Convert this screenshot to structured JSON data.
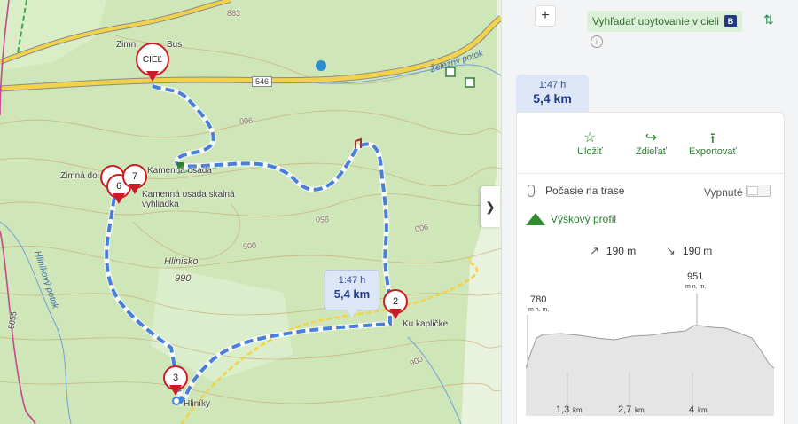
{
  "map": {
    "labels": {
      "cabin_top": "Zimn",
      "bus": "Bus",
      "road_number": "546",
      "peak_883": "883",
      "stream_zelezny": "Železný potok",
      "zimna_dolina": "Zimná dol",
      "kamenna_osada": "Kamenná osada",
      "kamenna_osada_skalna": "Kamenná osada skalná",
      "vyhliadka": "vyhliadka",
      "hlinisko": "Hlinisko",
      "hlinisko_elev": "990",
      "hlinikovy_potok": "Hliníkový potok",
      "ku_kaplicke": "Ku kapličke",
      "hliniky": "Hliníky",
      "contour_900_a": "900",
      "contour_950": "950",
      "contour_900_b": "900",
      "contour_006": "006",
      "contour_005": "005",
      "road_5855": "5855"
    },
    "pins": {
      "ciel": "CIEĽ",
      "p2": "2",
      "p3": "3",
      "p6": "6",
      "p7": "7"
    },
    "route_bubble": {
      "time": "1:47 h",
      "distance": "5,4 km"
    },
    "colors": {
      "route": "#4a7fd9",
      "pin": "#c81d25",
      "forest": "#cfe6b8",
      "road": "#f2d24a"
    }
  },
  "panel": {
    "add_button": "+",
    "accommodation": "Vyhľadať ubytovanie v cieli",
    "booking_badge": "B",
    "info": "i",
    "summary": {
      "time": "1:47 h",
      "distance": "5,4 km"
    },
    "actions": {
      "save": {
        "label": "Uložiť",
        "icon": "star-icon"
      },
      "share": {
        "label": "Zdieľať",
        "icon": "share-icon"
      },
      "export": {
        "label": "Exportovať",
        "icon": "upload-icon"
      }
    },
    "weather": {
      "label": "Počasie na trase",
      "toggle_label": "Vypnuté"
    },
    "elevation_title": "Výškový profil",
    "ascent": "190 m",
    "descent": "190 m",
    "profile": {
      "start_value": "780",
      "start_unit": "m n. m.",
      "max_value": "951",
      "max_unit": "m n. m.",
      "ticks": [
        "1,3",
        "2,7",
        "4"
      ],
      "tick_unit": "km"
    }
  }
}
